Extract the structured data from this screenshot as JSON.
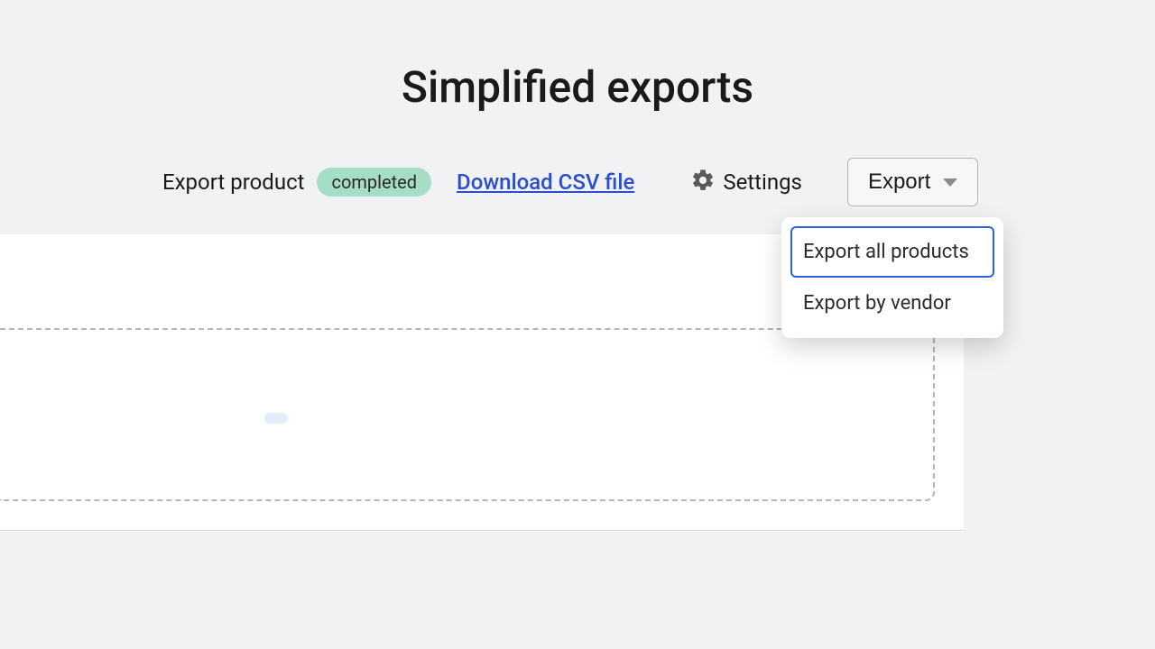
{
  "page": {
    "title": "Simplified exports"
  },
  "toolbar": {
    "export_label": "Export product",
    "status": "completed",
    "download_link": "Download CSV file",
    "settings_label": "Settings",
    "export_button": "Export"
  },
  "dropdown": {
    "items": [
      {
        "label": "Export all products",
        "focused": true
      },
      {
        "label": "Export by vendor",
        "focused": false
      }
    ]
  },
  "colors": {
    "badge_bg": "#a6ddc6",
    "link": "#2e4dcc",
    "focus_border": "#2b63d6"
  }
}
